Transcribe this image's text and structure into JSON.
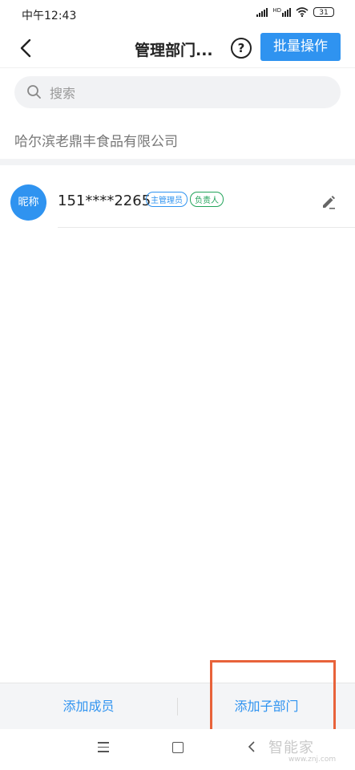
{
  "status_bar": {
    "time": "中午12:43",
    "battery": "31",
    "hd": "HD"
  },
  "nav": {
    "title": "管理部门...",
    "help": "?",
    "batch_label": "批量操作"
  },
  "search": {
    "placeholder": "搜索"
  },
  "company": "哈尔滨老鼎丰食品有限公司",
  "member": {
    "avatar_text": "昵称",
    "name": "151****2265",
    "badges": [
      "主管理员",
      "负责人"
    ]
  },
  "bottom": {
    "add_member": "添加成员",
    "add_subdept": "添加子部门"
  },
  "watermark": {
    "brand": "智能家",
    "url": "www.znj.com"
  },
  "colors": {
    "accent": "#2f93f0",
    "badge_green": "#22a35a",
    "highlight": "#e8623a"
  }
}
